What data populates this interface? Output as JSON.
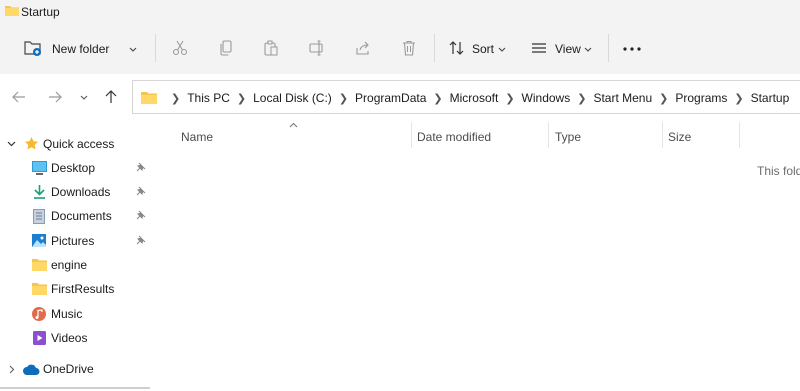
{
  "window": {
    "title": "Startup"
  },
  "toolbar": {
    "new_folder_label": "New folder",
    "sort_label": "Sort",
    "view_label": "View"
  },
  "address": {
    "crumbs": [
      "This PC",
      "Local Disk (C:)",
      "ProgramData",
      "Microsoft",
      "Windows",
      "Start Menu",
      "Programs",
      "Startup"
    ]
  },
  "sidebar": {
    "quick_access": "Quick access",
    "items": [
      {
        "label": "Desktop",
        "icon": "desktop-icon",
        "pinned": true
      },
      {
        "label": "Downloads",
        "icon": "downloads-icon",
        "pinned": true
      },
      {
        "label": "Documents",
        "icon": "documents-icon",
        "pinned": true
      },
      {
        "label": "Pictures",
        "icon": "pictures-icon",
        "pinned": true
      },
      {
        "label": "engine",
        "icon": "folder-icon",
        "pinned": false
      },
      {
        "label": "FirstResults",
        "icon": "folder-icon",
        "pinned": false
      },
      {
        "label": "Music",
        "icon": "music-icon",
        "pinned": false
      },
      {
        "label": "Videos",
        "icon": "videos-icon",
        "pinned": false
      }
    ],
    "onedrive": "OneDrive"
  },
  "columns": {
    "name": "Name",
    "date_modified": "Date modified",
    "type": "Type",
    "size": "Size"
  },
  "content": {
    "empty_text": "This fold"
  },
  "colors": {
    "toolbar_bg": "#f3f3f3",
    "folder_yellow": "#f5c64f",
    "accent_blue": "#0f6cbd"
  }
}
